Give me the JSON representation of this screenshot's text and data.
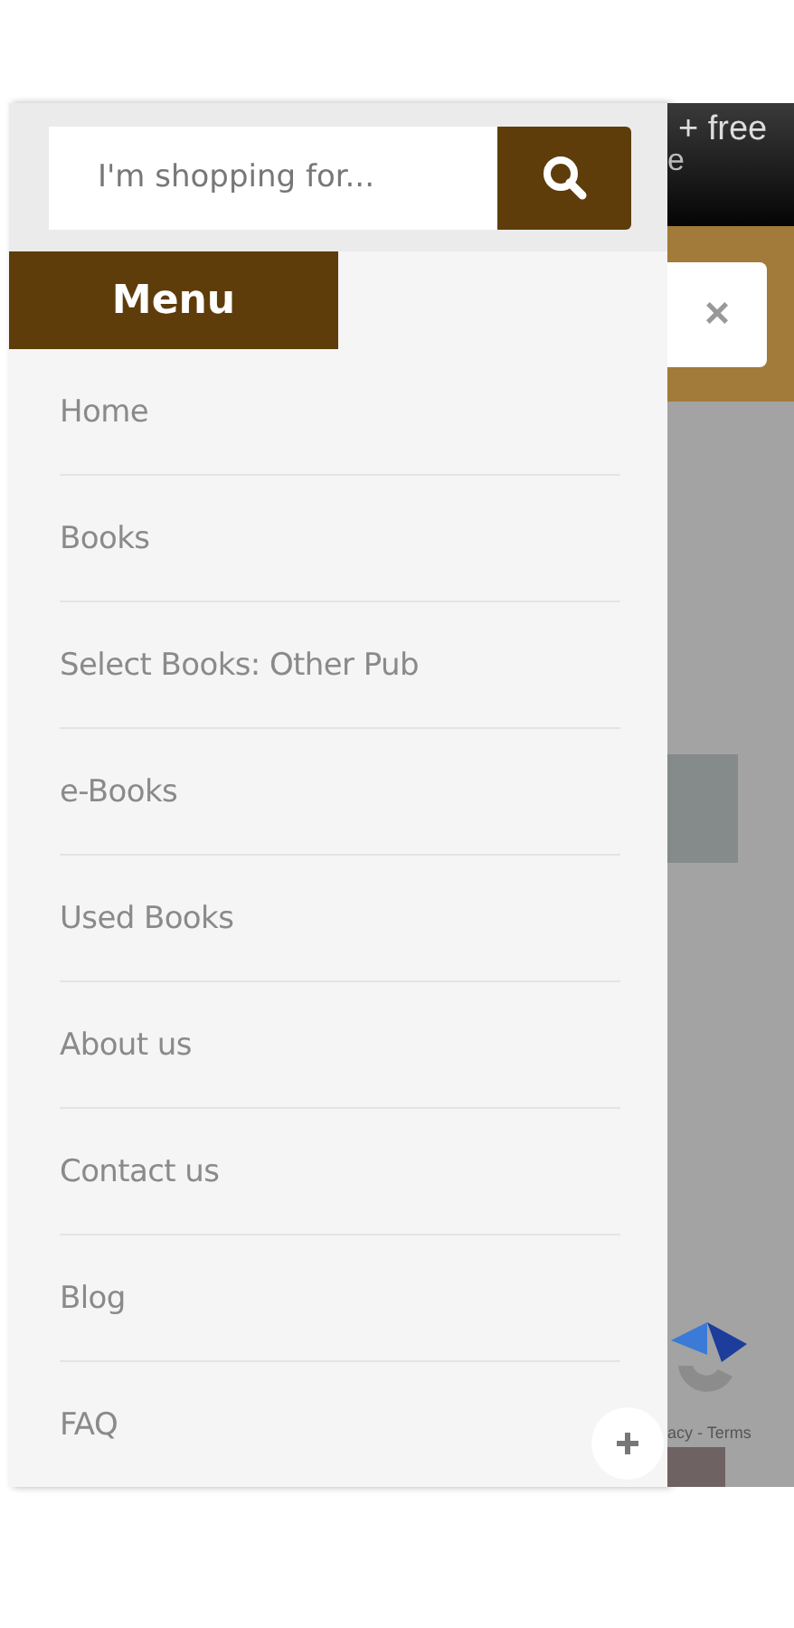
{
  "search": {
    "placeholder": "I'm shopping for..."
  },
  "menu": {
    "title": "Menu",
    "items": [
      {
        "label": "Home",
        "expandable": false
      },
      {
        "label": "Books",
        "expandable": false
      },
      {
        "label": "Select Books: Other Pub",
        "expandable": false
      },
      {
        "label": "e-Books",
        "expandable": false
      },
      {
        "label": "Used Books",
        "expandable": false
      },
      {
        "label": "About us",
        "expandable": false
      },
      {
        "label": "Contact us",
        "expandable": false
      },
      {
        "label": "Blog",
        "expandable": false
      },
      {
        "label": "FAQ",
        "expandable": true
      }
    ]
  },
  "background_page": {
    "banner_text": "+ free",
    "banner_text_2": "e",
    "close_symbol": "×",
    "captcha_text": "acy - Terms"
  }
}
